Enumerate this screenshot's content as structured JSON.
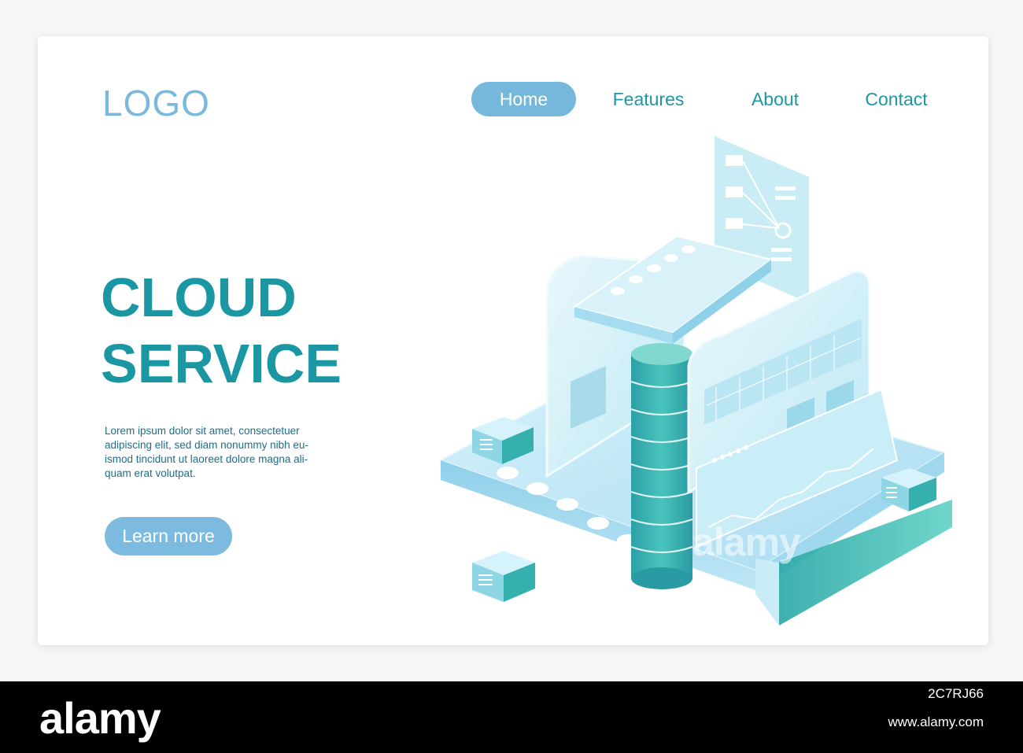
{
  "header": {
    "logo": "LOGO",
    "nav": [
      {
        "label": "Home",
        "active": true
      },
      {
        "label": "Features",
        "active": false
      },
      {
        "label": "About",
        "active": false
      },
      {
        "label": "Contact",
        "active": false
      }
    ]
  },
  "hero": {
    "title_line1": "CLOUD",
    "title_line2": "SERVICE",
    "body_lines": [
      "Lorem ipsum dolor sit amet, consectetuer",
      "adipiscing elit, sed diam nonummy nibh eu-",
      "ismod tincidunt ut laoreet dolore magna ali-",
      "quam erat volutpat."
    ],
    "cta_label": "Learn more"
  },
  "illustration": {
    "icon": "cloud-server-isometric-icon",
    "watermark": "alamy"
  },
  "footer": {
    "brand": "alamy",
    "image_id": "2C7RJ66",
    "url": "www.alamy.com"
  },
  "colors": {
    "accent": "#1a97a3",
    "pill": "#76b8dc",
    "logo": "#78b9dd",
    "body_text": "#1b6e8b"
  }
}
